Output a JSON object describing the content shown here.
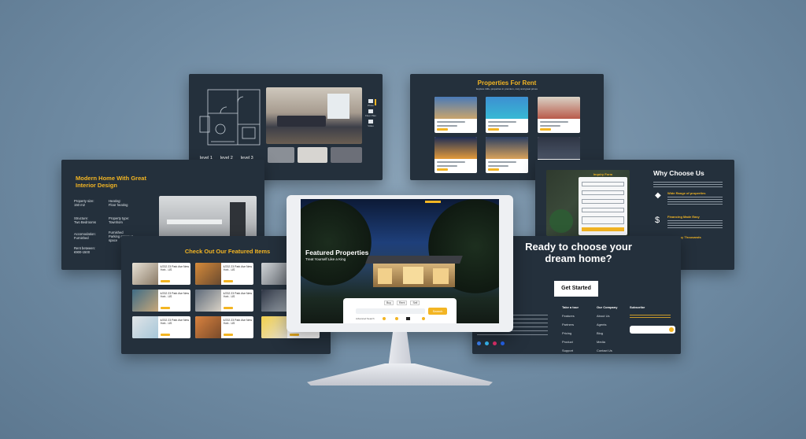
{
  "panels": {
    "floorplan": {
      "side_icons": [
        "Photo",
        "Floor Plan",
        "Video"
      ],
      "tabs": [
        "level 1",
        "level 2",
        "level 3"
      ]
    },
    "rent": {
      "title": "Properties For Rent",
      "subtitle": "Explore 100+ properties in premium, cozy and great prices",
      "cards": [
        {
          "title": "Sustainable Property Home",
          "price": "$750/mo"
        },
        {
          "title": "Sustainable Property Home",
          "price": "$750/mo"
        },
        {
          "title": "Sustainable Property Home",
          "price": "$750/mo"
        },
        {
          "title": "Sustainable Property Home",
          "price": "$750/mo"
        },
        {
          "title": "Sustainable Property Home",
          "price": "$750/mo"
        },
        {
          "title": "Sustainable Property Home",
          "price": "$750/mo"
        }
      ]
    },
    "modern": {
      "title": "Modern Home With Great Interior Design",
      "rows": [
        {
          "label1": "Property size:",
          "val1": "150 m2",
          "label2": "Heating:",
          "val2": "Floor heating"
        },
        {
          "label1": "Structure:",
          "val1": "Two Bedrooms",
          "label2": "Property type:",
          "val2": "Townhom"
        },
        {
          "label1": "Accomodation:",
          "val1": "Furnished",
          "label2": "Furnished",
          "val2": "Parking space: 1 space"
        },
        {
          "label1": "Rent between:",
          "val1": "€900-1500",
          "label2": "",
          "val2": ""
        }
      ]
    },
    "why": {
      "title": "Why Choose Us",
      "form_title": "Inquiry Form",
      "features": [
        "Wide Range of properties",
        "Financing Made Easy",
        "Trusted by Thousands"
      ]
    },
    "featured_items": {
      "title": "Check Out Our Featured Items",
      "cards": [
        {
          "title": "4/232 23 Park Ave New York - US",
          "price": "$2,500"
        },
        {
          "title": "4/232 23 Park Ave New York - US",
          "price": "$2,500"
        },
        {
          "title": "4/232 23 Park Ave New York - US",
          "price": "$2,500"
        },
        {
          "title": "4/232 23 Park Ave New York - US",
          "price": "$2,500"
        },
        {
          "title": "4/232 23 Park Ave New York - US",
          "price": "$2,500"
        },
        {
          "title": "4/232 23 Park Ave New York - US",
          "price": "$2,500"
        }
      ]
    },
    "cta": {
      "title": "Ready to choose your dream home?",
      "button": "Get Started",
      "cols": [
        {
          "heading": "Take a tour",
          "links": [
            "Features",
            "Partners",
            "Pricing",
            "Product",
            "Support"
          ]
        },
        {
          "heading": "Our Company",
          "links": [
            "About Us",
            "Agents",
            "Blog",
            "Media",
            "Contact Us"
          ]
        },
        {
          "heading": "Subscribe",
          "links": []
        }
      ]
    }
  },
  "monitor": {
    "hero_title": "Featured Properties",
    "hero_subtitle": "Treat Yourself Like a King",
    "search_tabs": [
      "Buy",
      "Rent",
      "Sell"
    ],
    "search_button": "Search",
    "footer_label": "Advanced Search"
  },
  "colors": {
    "accent": "#f3b523",
    "panel": "#24303c",
    "background": "#6f8ba3"
  }
}
